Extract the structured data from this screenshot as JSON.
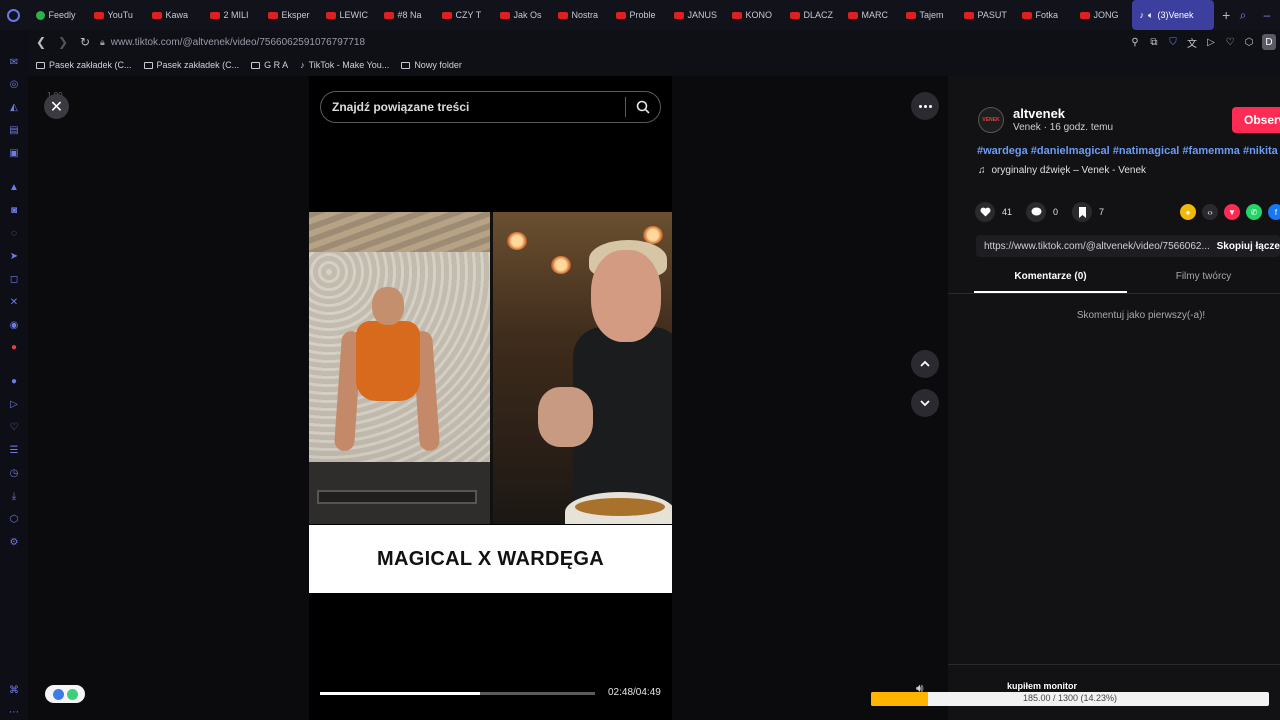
{
  "browser": {
    "tabs": [
      {
        "label": "Feedly",
        "icon": "feedly-icon"
      },
      {
        "label": "YouTu",
        "icon": "youtube-icon"
      },
      {
        "label": "Kawa",
        "icon": "youtube-icon"
      },
      {
        "label": "2 MILI",
        "icon": "youtube-icon"
      },
      {
        "label": "Eksper",
        "icon": "youtube-icon"
      },
      {
        "label": "LEWIC",
        "icon": "youtube-icon"
      },
      {
        "label": "#8 Na",
        "icon": "youtube-icon"
      },
      {
        "label": "CZY T",
        "icon": "youtube-icon"
      },
      {
        "label": "Jak Os",
        "icon": "youtube-icon"
      },
      {
        "label": "Nostra",
        "icon": "youtube-icon"
      },
      {
        "label": "Proble",
        "icon": "youtube-icon"
      },
      {
        "label": "JANUS",
        "icon": "youtube-icon"
      },
      {
        "label": "KONO",
        "icon": "youtube-icon"
      },
      {
        "label": "DLACZ",
        "icon": "youtube-icon"
      },
      {
        "label": "MARC",
        "icon": "youtube-icon"
      },
      {
        "label": "Tajem",
        "icon": "youtube-icon"
      },
      {
        "label": "PASUT",
        "icon": "youtube-icon"
      },
      {
        "label": "Fotka",
        "icon": "youtube-icon"
      },
      {
        "label": "JONG",
        "icon": "youtube-icon"
      }
    ],
    "active_tab": {
      "label": "(3)Venek",
      "icon": "tiktok-icon"
    },
    "new_tab": "+",
    "url": "www.tiktok.com/@altvenek/video/7566062591076797718",
    "profile_letter": "D",
    "bookmarks": [
      {
        "label": "Pasek zakładek (C...",
        "icon": "folder-icon"
      },
      {
        "label": "Pasek zakładek (C...",
        "icon": "folder-icon"
      },
      {
        "label": "G R A",
        "icon": "folder-icon"
      },
      {
        "label": "TikTok - Make You...",
        "icon": "tiktok-icon"
      },
      {
        "label": "Nowy folder",
        "icon": "folder-icon"
      }
    ]
  },
  "page": {
    "zoom_label": "1.00",
    "search": {
      "placeholder": "Znajdź powiązane treści"
    },
    "video_caption": "MAGICAL X WARDĘGA",
    "time": "02:48/04:49",
    "progress_fraction": 0.58
  },
  "post": {
    "author": "altvenek",
    "avatar_text": "VENEK",
    "meta": "Venek · 16 godz. temu",
    "follow_label": "Obserwuj",
    "hashtags": "#wardega #danielmagical #natimagical #famemma #nikita",
    "sound": "oryginalny dźwięk – Venek - Venek",
    "likes": "41",
    "comments": "0",
    "saves": "7",
    "link": "https://www.tiktok.com/@altvenek/video/7566062...",
    "copy_link_label": "Skopiuj łącze",
    "tab_comments": "Komentarze (0)",
    "tab_creator_videos": "Filmy twórcy",
    "empty_comments": "Skomentuj jako pierwszy(-a)!"
  },
  "overlay": {
    "title": "kupiłem monitor",
    "progress_text": "185.00 / 1300 (14.23%)",
    "progress_fraction": 0.1423
  },
  "colors": {
    "accent": "#fe2c55",
    "hashtag": "#6b9cf4",
    "browser_accent": "#6b74e8",
    "overlay_fill": "#ffb400"
  }
}
